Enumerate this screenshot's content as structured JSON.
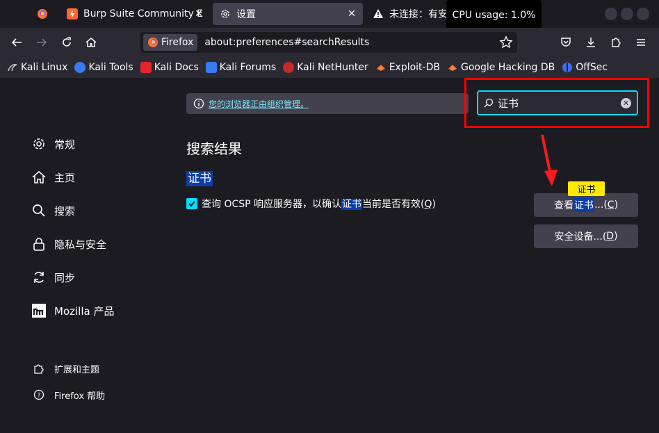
{
  "tabs": {
    "burp": "Burp Suite Community E",
    "settings": "设置",
    "warning": "未连接：有安全"
  },
  "cpu_tooltip": "CPU usage: 1.0%",
  "urlbar": {
    "identity_label": "Firefox",
    "url": "about:preferences#searchResults"
  },
  "bookmarks": [
    "Kali Linux",
    "Kali Tools",
    "Kali Docs",
    "Kali Forums",
    "Kali NetHunter",
    "Exploit-DB",
    "Google Hacking DB",
    "OffSec"
  ],
  "managed_notice": "您的浏览器正由组织管理。",
  "search": {
    "value": "证书"
  },
  "sidebar": {
    "items": [
      "常规",
      "主页",
      "搜索",
      "隐私与安全",
      "同步",
      "Mozilla 产品"
    ],
    "footer": [
      "扩展和主题",
      "Firefox 帮助"
    ]
  },
  "results": {
    "title": "搜索结果",
    "section": "证书",
    "ocsp_before": "查询 OCSP 响应服务器，以确认",
    "ocsp_highlight": "证书",
    "ocsp_after": "当前是否有效(",
    "ocsp_key": "Q",
    "ocsp_end": ")"
  },
  "buttons": {
    "view_before": "查看",
    "view_highlight": "证书",
    "view_after": "...(",
    "view_key": "C",
    "view_end": ")",
    "security_label": "安全设备...(",
    "security_key": "D",
    "security_end": ")"
  },
  "tooltip_term": "证书",
  "colors": {
    "accent": "#00ddff",
    "highlight": "#0a3fa8",
    "annotation_red": "#ff0000",
    "tooltip_yellow": "#ffe900"
  }
}
